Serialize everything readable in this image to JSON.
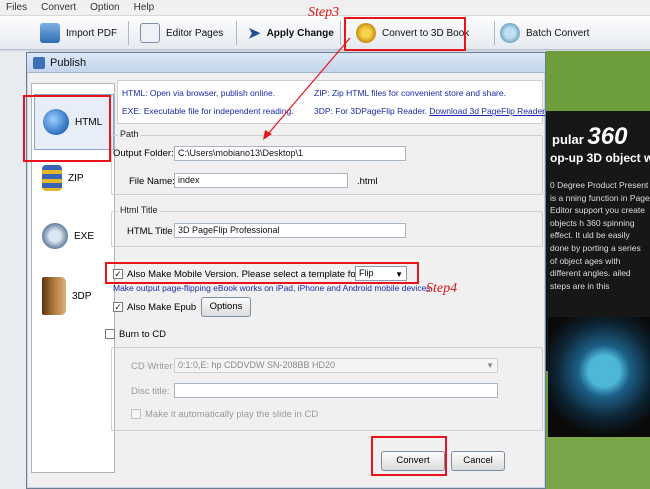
{
  "menu": [
    "Files",
    "Convert",
    "Option",
    "Help"
  ],
  "toolbar": {
    "import_pdf": "Import PDF",
    "editor_pages": "Editor Pages",
    "apply_change": "Apply Change",
    "convert_3d": "Convert to 3D Book",
    "batch_convert": "Batch Convert"
  },
  "background": {
    "headline": "pular",
    "headline_num": "360",
    "subline": "op-up 3D object w",
    "paragraph": "0 Degree Product Present is a nning function in Page Editor support you create objects h 360 spinning effect. It uld be easily done by porting a series of object ages with different angles. ailed steps are in this "
  },
  "dialog": {
    "title": "Publish",
    "sidebar": [
      "HTML",
      "ZIP",
      "EXE",
      "3DP"
    ],
    "info": {
      "html": "HTML: Open via browser, publish online.",
      "zip": "ZIP: Zip HTML files for convenient store and share.",
      "exe": "EXE: Executable file for independent reading.",
      "tdp": "3DP: For 3DPageFlip Reader.",
      "download_link": "Download 3d PageFlip Reader"
    },
    "path_group": "Path",
    "output_folder_label": "Output Folder:",
    "output_folder_value": "C:\\Users\\mobiano13\\Desktop\\1",
    "file_name_label": "File Name:",
    "file_name_value": "index",
    "file_ext": ".html",
    "html_title_group": "Html Title",
    "html_title_label": "HTML Title",
    "html_title_value": "3D PageFlip Professional",
    "mobile_label": "Also Make Mobile Version. Please select a template for mobile:",
    "mobile_template": "Flip",
    "mobile_hint": "Make output page-flipping eBook works on iPad, iPhone and Android mobile devices",
    "epub_label": "Also Make Epub",
    "options_button": "Options",
    "burn_label": "Burn to CD",
    "cd_writer_label": "CD Writer",
    "cd_writer_value": "0:1:0,E: hp       CDDVDW SN-208BB  HD20",
    "disc_title_label": "Disc title:",
    "autoplay_label": "Make it automatically play the  slide in CD",
    "convert_button": "Convert",
    "cancel_button": "Cancel"
  },
  "annotations": {
    "step3": "Step3",
    "step4": "Step4"
  },
  "colors": {
    "annotation_red": "#e8141c",
    "link_blue": "#1a2aa8"
  }
}
